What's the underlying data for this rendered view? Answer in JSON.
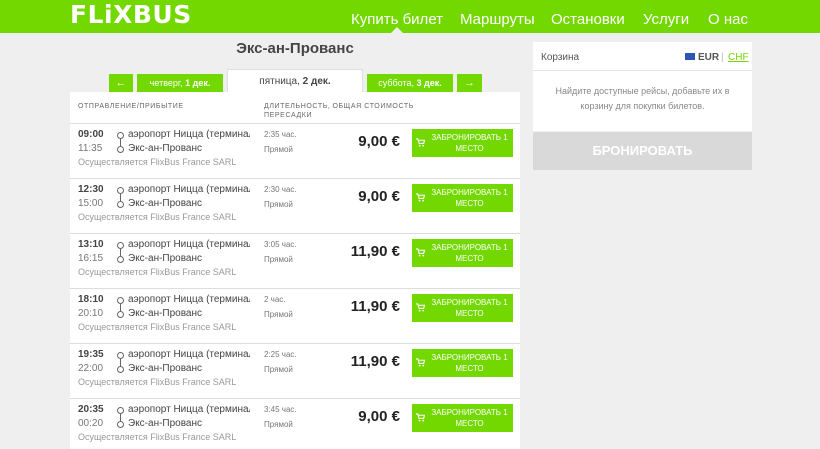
{
  "header": {
    "logo": "FLiXBUS",
    "nav": [
      {
        "label": "Купить билет"
      },
      {
        "label": "Маршруты"
      },
      {
        "label": "Остановки"
      },
      {
        "label": "Услуги"
      },
      {
        "label": "О нас"
      }
    ]
  },
  "search": {
    "city": "Экс-ан-Прованс",
    "prev_arrow": "←",
    "next_arrow": "→",
    "days": {
      "prev": {
        "weekday": "четверг,",
        "date": "1 дек."
      },
      "current": {
        "weekday": "пятница,",
        "date": "2 дек."
      },
      "next": {
        "weekday": "суббота,",
        "date": "3 дек."
      }
    }
  },
  "columns": {
    "departure_arrival": "Отправление/прибытие",
    "duration": "Длительность,",
    "transfers": "пересадки",
    "total_cost": "общая стоимость"
  },
  "rides": [
    {
      "dep": "09:00",
      "arr": "11:35",
      "from": "аэропорт Ницца (терминал 2)",
      "to": "Экс-ан-Прованс",
      "operator": "Осуществляется FlixBus France SARL",
      "duration": "2:35 час.",
      "transfer": "Прямой",
      "price": "9,00 €",
      "book": "Забронировать 1 место"
    },
    {
      "dep": "12:30",
      "arr": "15:00",
      "from": "аэропорт Ницца (терминал 2)",
      "to": "Экс-ан-Прованс",
      "operator": "Осуществляется FlixBus France SARL",
      "duration": "2:30 час.",
      "transfer": "Прямой",
      "price": "9,00 €",
      "book": "Забронировать 1 место"
    },
    {
      "dep": "13:10",
      "arr": "16:15",
      "from": "аэропорт Ницца (терминал 2)",
      "to": "Экс-ан-Прованс",
      "operator": "Осуществляется FlixBus France SARL",
      "duration": "3:05 час.",
      "transfer": "Прямой",
      "price": "11,90 €",
      "book": "Забронировать 1 место"
    },
    {
      "dep": "18:10",
      "arr": "20:10",
      "from": "аэропорт Ницца (терминал 2)",
      "to": "Экс-ан-Прованс",
      "operator": "Осуществляется FlixBus France SARL",
      "duration": "2 час.",
      "transfer": "Прямой",
      "price": "11,90 €",
      "book": "Забронировать 1 место"
    },
    {
      "dep": "19:35",
      "arr": "22:00",
      "from": "аэропорт Ницца (терминал 2)",
      "to": "Экс-ан-Прованс",
      "operator": "Осуществляется FlixBus France SARL",
      "duration": "2:25 час.",
      "transfer": "Прямой",
      "price": "11,90 €",
      "book": "Забронировать 1 место"
    },
    {
      "dep": "20:35",
      "arr": "00:20",
      "from": "аэропорт Ницца (терминал 2)",
      "to": "Экс-ан-Прованс",
      "operator": "Осуществляется FlixBus France SARL",
      "duration": "3:45 час.",
      "transfer": "Прямой",
      "price": "9,00 €",
      "book": "Забронировать 1 место"
    }
  ],
  "cart": {
    "title": "Корзина",
    "currency_eur": "EUR",
    "separator": "|",
    "currency_chf": "CHF",
    "empty_message": "Найдите доступные рейсы, добавьте их в корзину для покупки билетов.",
    "checkout": "Бронировать"
  },
  "colors": {
    "brand": "#73d700",
    "disabled": "#d9d9d9"
  },
  "icons": {
    "cart": "cart-icon",
    "flag": "eu-flag-icon"
  }
}
